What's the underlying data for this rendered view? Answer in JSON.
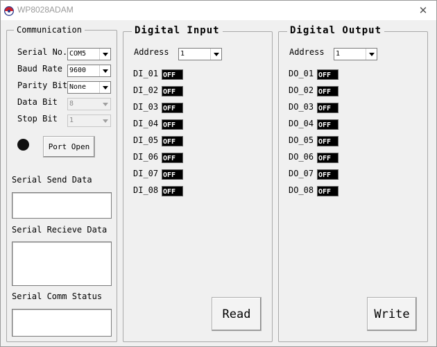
{
  "window": {
    "title": "WP8028ADAM"
  },
  "communication": {
    "title": "Communication",
    "serial_no": {
      "label": "Serial No.",
      "value": "COM5"
    },
    "baud_rate": {
      "label": "Baud Rate",
      "value": "9600"
    },
    "parity_bit": {
      "label": "Parity Bit",
      "value": "None"
    },
    "data_bit": {
      "label": "Data Bit",
      "value": "8"
    },
    "stop_bit": {
      "label": "Stop Bit",
      "value": "1"
    },
    "port_open_label": "Port Open",
    "send_label": "Serial Send Data",
    "send_value": "",
    "recv_label": "Serial Recieve Data",
    "recv_value": "",
    "status_label": "Serial Comm Status",
    "status_value": ""
  },
  "digital_input": {
    "title": "Digital Input",
    "address_label": "Address",
    "address_value": "1",
    "channels": [
      {
        "label": "DI_01",
        "state": "OFF"
      },
      {
        "label": "DI_02",
        "state": "OFF"
      },
      {
        "label": "DI_03",
        "state": "OFF"
      },
      {
        "label": "DI_04",
        "state": "OFF"
      },
      {
        "label": "DI_05",
        "state": "OFF"
      },
      {
        "label": "DI_06",
        "state": "OFF"
      },
      {
        "label": "DI_07",
        "state": "OFF"
      },
      {
        "label": "DI_08",
        "state": "OFF"
      }
    ],
    "button_label": "Read"
  },
  "digital_output": {
    "title": "Digital Output",
    "address_label": "Address",
    "address_value": "1",
    "channels": [
      {
        "label": "DO_01",
        "state": "OFF"
      },
      {
        "label": "DO_02",
        "state": "OFF"
      },
      {
        "label": "DO_03",
        "state": "OFF"
      },
      {
        "label": "DO_04",
        "state": "OFF"
      },
      {
        "label": "DO_05",
        "state": "OFF"
      },
      {
        "label": "DO_06",
        "state": "OFF"
      },
      {
        "label": "DO_07",
        "state": "OFF"
      },
      {
        "label": "DO_08",
        "state": "OFF"
      }
    ],
    "button_label": "Write"
  },
  "icons": {
    "app": "app-logo-icon",
    "close": "close-icon",
    "dropdown": "chevron-down-icon",
    "status_led": "status-led-icon"
  },
  "colors": {
    "indicator_off_bg": "#000000",
    "indicator_off_text": "#ffffff",
    "led": "#111111",
    "window_bg": "#f0f0f0"
  }
}
